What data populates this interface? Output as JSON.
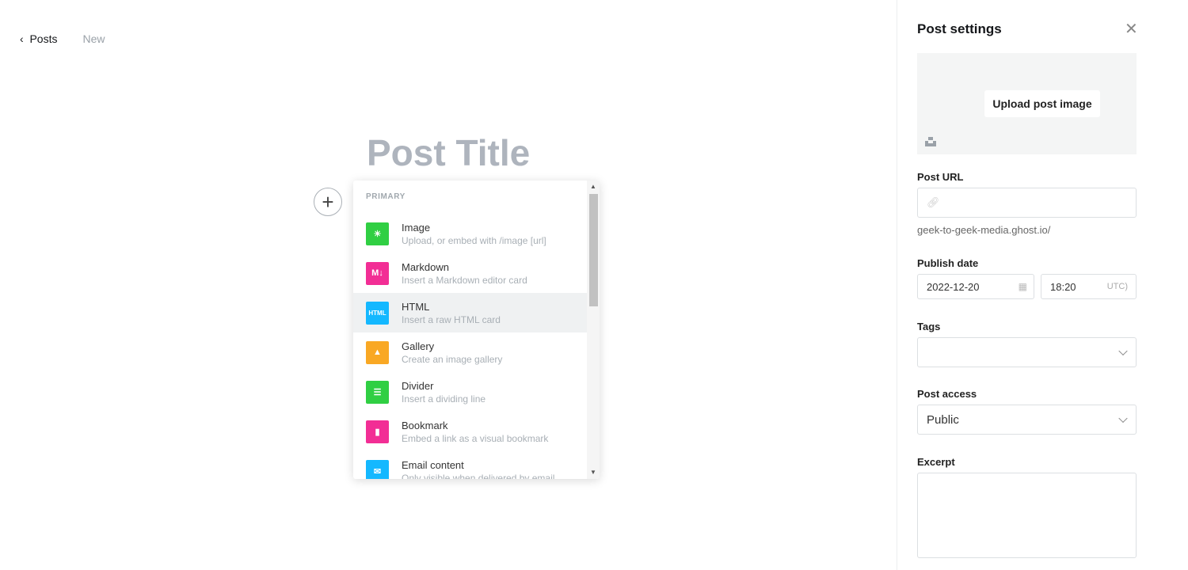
{
  "breadcrumb": {
    "back": "Posts",
    "current": "New"
  },
  "editor": {
    "title_placeholder": "Post Title"
  },
  "card_menu": {
    "section": "PRIMARY",
    "items": [
      {
        "title": "Image",
        "desc": "Upload, or embed with /image [url]",
        "icon": "image-icon",
        "color": "#30cf43",
        "glyph": "☀"
      },
      {
        "title": "Markdown",
        "desc": "Insert a Markdown editor card",
        "icon": "markdown-icon",
        "color": "#f22e95",
        "glyph": "M↓"
      },
      {
        "title": "HTML",
        "desc": "Insert a raw HTML card",
        "icon": "html-icon",
        "color": "#14b8ff",
        "glyph": "HTML"
      },
      {
        "title": "Gallery",
        "desc": "Create an image gallery",
        "icon": "gallery-icon",
        "color": "#f9a824",
        "glyph": "▲"
      },
      {
        "title": "Divider",
        "desc": "Insert a dividing line",
        "icon": "divider-icon",
        "color": "#30cf43",
        "glyph": "☰"
      },
      {
        "title": "Bookmark",
        "desc": "Embed a link as a visual bookmark",
        "icon": "bookmark-icon",
        "color": "#f22e95",
        "glyph": "▮"
      },
      {
        "title": "Email content",
        "desc": "Only visible when delivered by email",
        "icon": "email-icon",
        "color": "#14b8ff",
        "glyph": "✉"
      }
    ]
  },
  "settings": {
    "title": "Post settings",
    "upload_label": "Upload post image",
    "url_label": "Post URL",
    "url_value": "",
    "url_hint": "geek-to-geek-media.ghost.io/",
    "date_label": "Publish date",
    "date_value": "2022-12-20",
    "time_value": "18:20",
    "tz": "UTC)",
    "tags_label": "Tags",
    "access_label": "Post access",
    "access_value": "Public",
    "excerpt_label": "Excerpt"
  }
}
